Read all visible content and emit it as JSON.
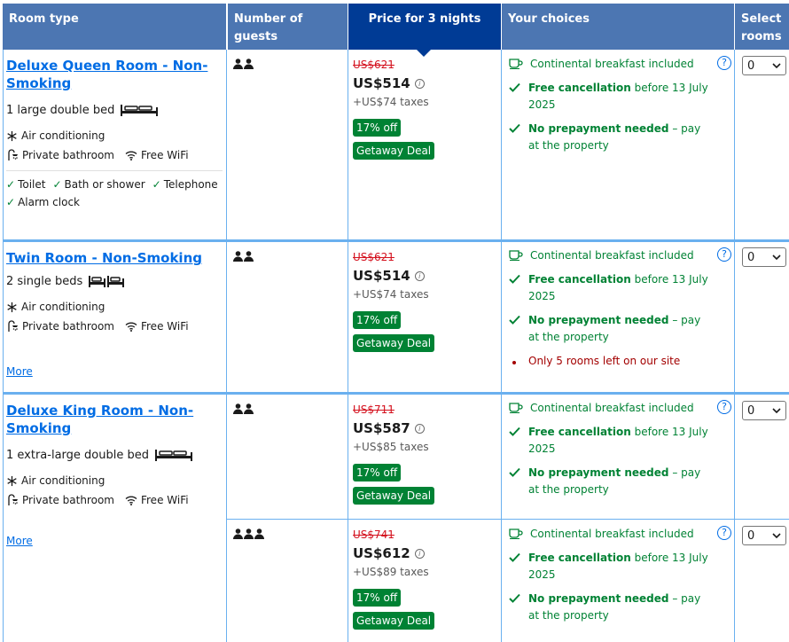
{
  "header": {
    "room_type": "Room type",
    "guests": "Number of guests",
    "price": "Price for 3 nights",
    "choices": "Your choices",
    "select": "Select rooms"
  },
  "rooms": [
    {
      "name": "Deluxe Queen Room - Non-Smoking",
      "bed": "1 large double bed",
      "facilities": [
        "Air conditioning",
        "Private bathroom",
        "Free WiFi"
      ],
      "amenities": [
        "Toilet",
        "Bath or shower",
        "Telephone",
        "Alarm clock"
      ],
      "options": [
        {
          "guests": 2,
          "old_price": "US$621",
          "price": "US$514",
          "taxes": "+US$74 taxes",
          "discount": "17% off",
          "deal": "Getaway Deal",
          "breakfast": "Continental breakfast included",
          "cancel_bold": "Free cancellation",
          "cancel_rest": " before 13 July 2025",
          "prepay_bold": "No prepayment needed",
          "prepay_rest": " – pay at the property",
          "selected": "0"
        }
      ]
    },
    {
      "name": "Twin Room - Non-Smoking",
      "bed": "2 single beds",
      "facilities": [
        "Air conditioning",
        "Private bathroom",
        "Free WiFi"
      ],
      "more": "More",
      "options": [
        {
          "guests": 2,
          "old_price": "US$621",
          "price": "US$514",
          "taxes": "+US$74 taxes",
          "discount": "17% off",
          "deal": "Getaway Deal",
          "breakfast": "Continental breakfast included",
          "cancel_bold": "Free cancellation",
          "cancel_rest": " before 13 July 2025",
          "prepay_bold": "No prepayment needed",
          "prepay_rest": " – pay at the property",
          "scarcity": "Only 5 rooms left on our site",
          "selected": "0"
        }
      ]
    },
    {
      "name": "Deluxe King Room - Non-Smoking",
      "bed": "1 extra-large double bed",
      "facilities": [
        "Air conditioning",
        "Private bathroom",
        "Free WiFi"
      ],
      "more": "More",
      "options": [
        {
          "guests": 2,
          "old_price": "US$711",
          "price": "US$587",
          "taxes": "+US$85 taxes",
          "discount": "17% off",
          "deal": "Getaway Deal",
          "breakfast": "Continental breakfast included",
          "cancel_bold": "Free cancellation",
          "cancel_rest": " before 13 July 2025",
          "prepay_bold": "No prepayment needed",
          "prepay_rest": " – pay at the property",
          "selected": "0"
        },
        {
          "guests": 3,
          "old_price": "US$741",
          "price": "US$612",
          "taxes": "+US$89 taxes",
          "discount": "17% off",
          "deal": "Getaway Deal",
          "breakfast": "Continental breakfast included",
          "cancel_bold": "Free cancellation",
          "cancel_rest": " before 13 July 2025",
          "prepay_bold": "No prepayment needed",
          "prepay_rest": " – pay at the property",
          "selected": "0"
        }
      ]
    }
  ],
  "icons": {
    "guest": "person-icon",
    "bed": "bed-icon",
    "ac": "snowflake-icon",
    "bath": "shower-icon",
    "wifi": "wifi-icon",
    "check": "checkmark-icon",
    "breakfast": "coffee-cup-icon",
    "help": "question-icon",
    "info": "info-icon"
  },
  "colors": {
    "header": "#4c76b2",
    "header_active": "#003b95",
    "link": "#006ce4",
    "green": "#008234",
    "strike": "#d4111e",
    "warning": "#a30000"
  }
}
